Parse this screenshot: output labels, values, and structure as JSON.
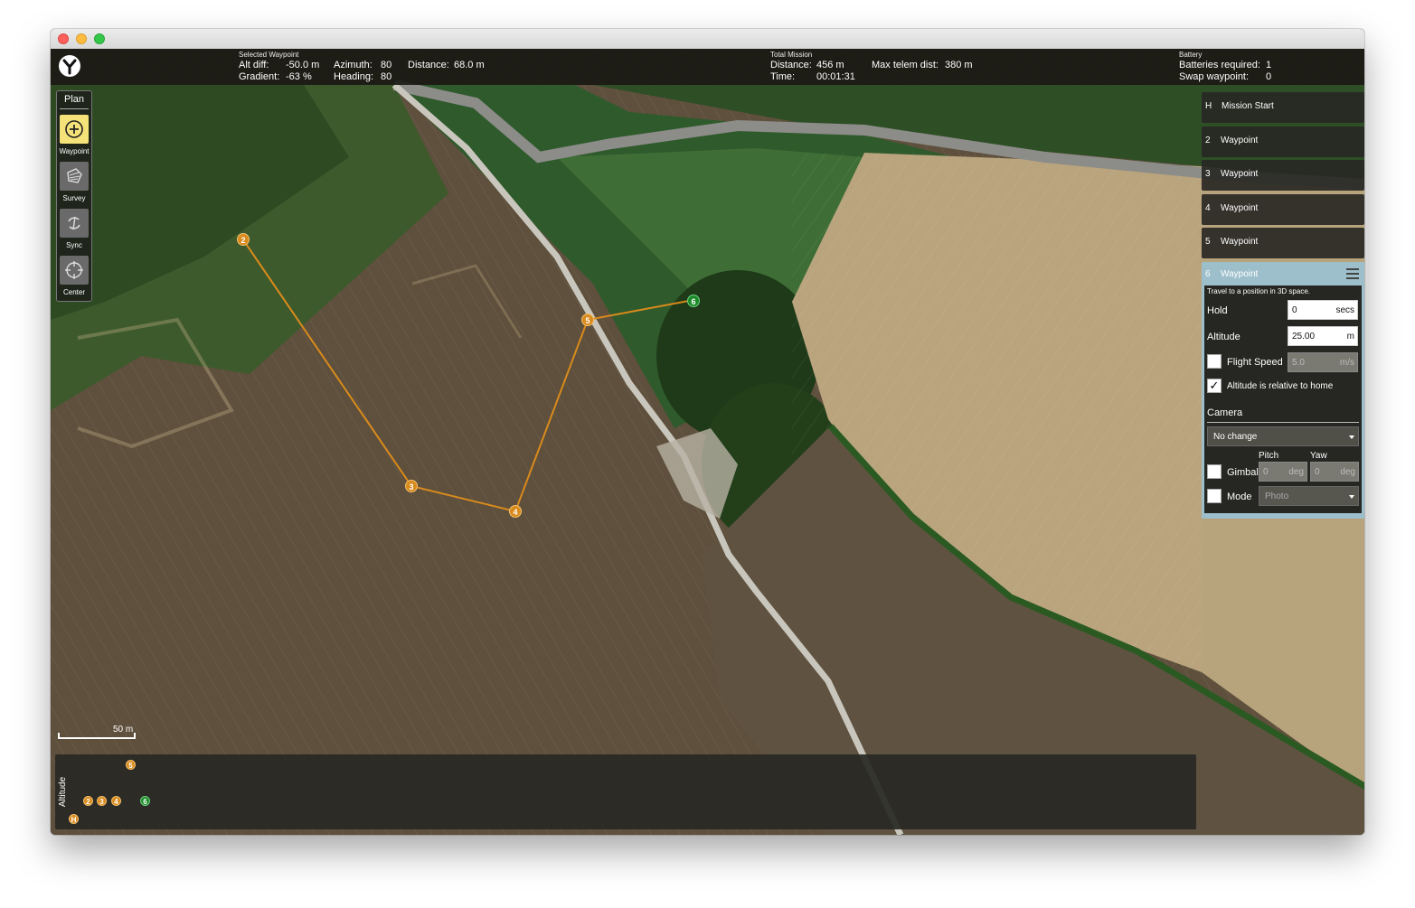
{
  "top_bar": {
    "selected": {
      "heading": "Selected Waypoint",
      "alt_diff_label": "Alt diff:",
      "alt_diff_value": "-50.0 m",
      "azimuth_label": "Azimuth:",
      "azimuth_value": "80",
      "distance_label": "Distance:",
      "distance_value": "68.0 m",
      "gradient_label": "Gradient:",
      "gradient_value": "-63 %",
      "heading_label": "Heading:",
      "heading_value": "80"
    },
    "total": {
      "heading": "Total Mission",
      "distance_label": "Distance:",
      "distance_value": "456 m",
      "max_telem_label": "Max telem dist:",
      "max_telem_value": "380 m",
      "time_label": "Time:",
      "time_value": "00:01:31"
    },
    "battery": {
      "heading": "Battery",
      "required_label": "Batteries required:",
      "required_value": "1",
      "swap_label": "Swap waypoint:",
      "swap_value": "0"
    }
  },
  "toolbox": {
    "title": "Plan",
    "tools": [
      {
        "label": "Waypoint",
        "icon": "plus-circle-icon",
        "active": true
      },
      {
        "label": "Survey",
        "icon": "survey-polygon-icon",
        "active": false
      },
      {
        "label": "Sync",
        "icon": "sync-icon",
        "active": false
      },
      {
        "label": "Center",
        "icon": "crosshair-icon",
        "active": false
      }
    ]
  },
  "mission_items": [
    {
      "num": "H",
      "name": "Mission Start"
    },
    {
      "num": "2",
      "name": "Waypoint"
    },
    {
      "num": "3",
      "name": "Waypoint"
    },
    {
      "num": "4",
      "name": "Waypoint"
    },
    {
      "num": "5",
      "name": "Waypoint"
    }
  ],
  "editor": {
    "num": "6",
    "name": "Waypoint",
    "description": "Travel to a position in 3D space.",
    "hold_label": "Hold",
    "hold_value": "0",
    "hold_unit": "secs",
    "altitude_label": "Altitude",
    "altitude_value": "25.00",
    "altitude_unit": "m",
    "flight_speed_label": "Flight Speed",
    "flight_speed_value": "5.0",
    "flight_speed_unit": "m/s",
    "flight_speed_checked": false,
    "relative_label": "Altitude is relative to home",
    "relative_checked": true,
    "camera_label": "Camera",
    "camera_value": "No change",
    "pitch_label": "Pitch",
    "yaw_label": "Yaw",
    "gimbal_label": "Gimbal",
    "pitch_value": "0",
    "pitch_unit": "deg",
    "yaw_value": "0",
    "yaw_unit": "deg",
    "mode_label": "Mode",
    "mode_value": "Photo"
  },
  "map": {
    "scale_label": "50 m",
    "route_color": "#d98a1c",
    "current_color": "#1c8a2a",
    "waypoints": [
      {
        "label": "2"
      },
      {
        "label": "3"
      },
      {
        "label": "4"
      },
      {
        "label": "5"
      },
      {
        "label": "6",
        "current": true
      }
    ]
  },
  "altitude_view": {
    "label": "Altitude",
    "markers": [
      "H",
      "2",
      "3",
      "4",
      "5",
      "6"
    ]
  }
}
